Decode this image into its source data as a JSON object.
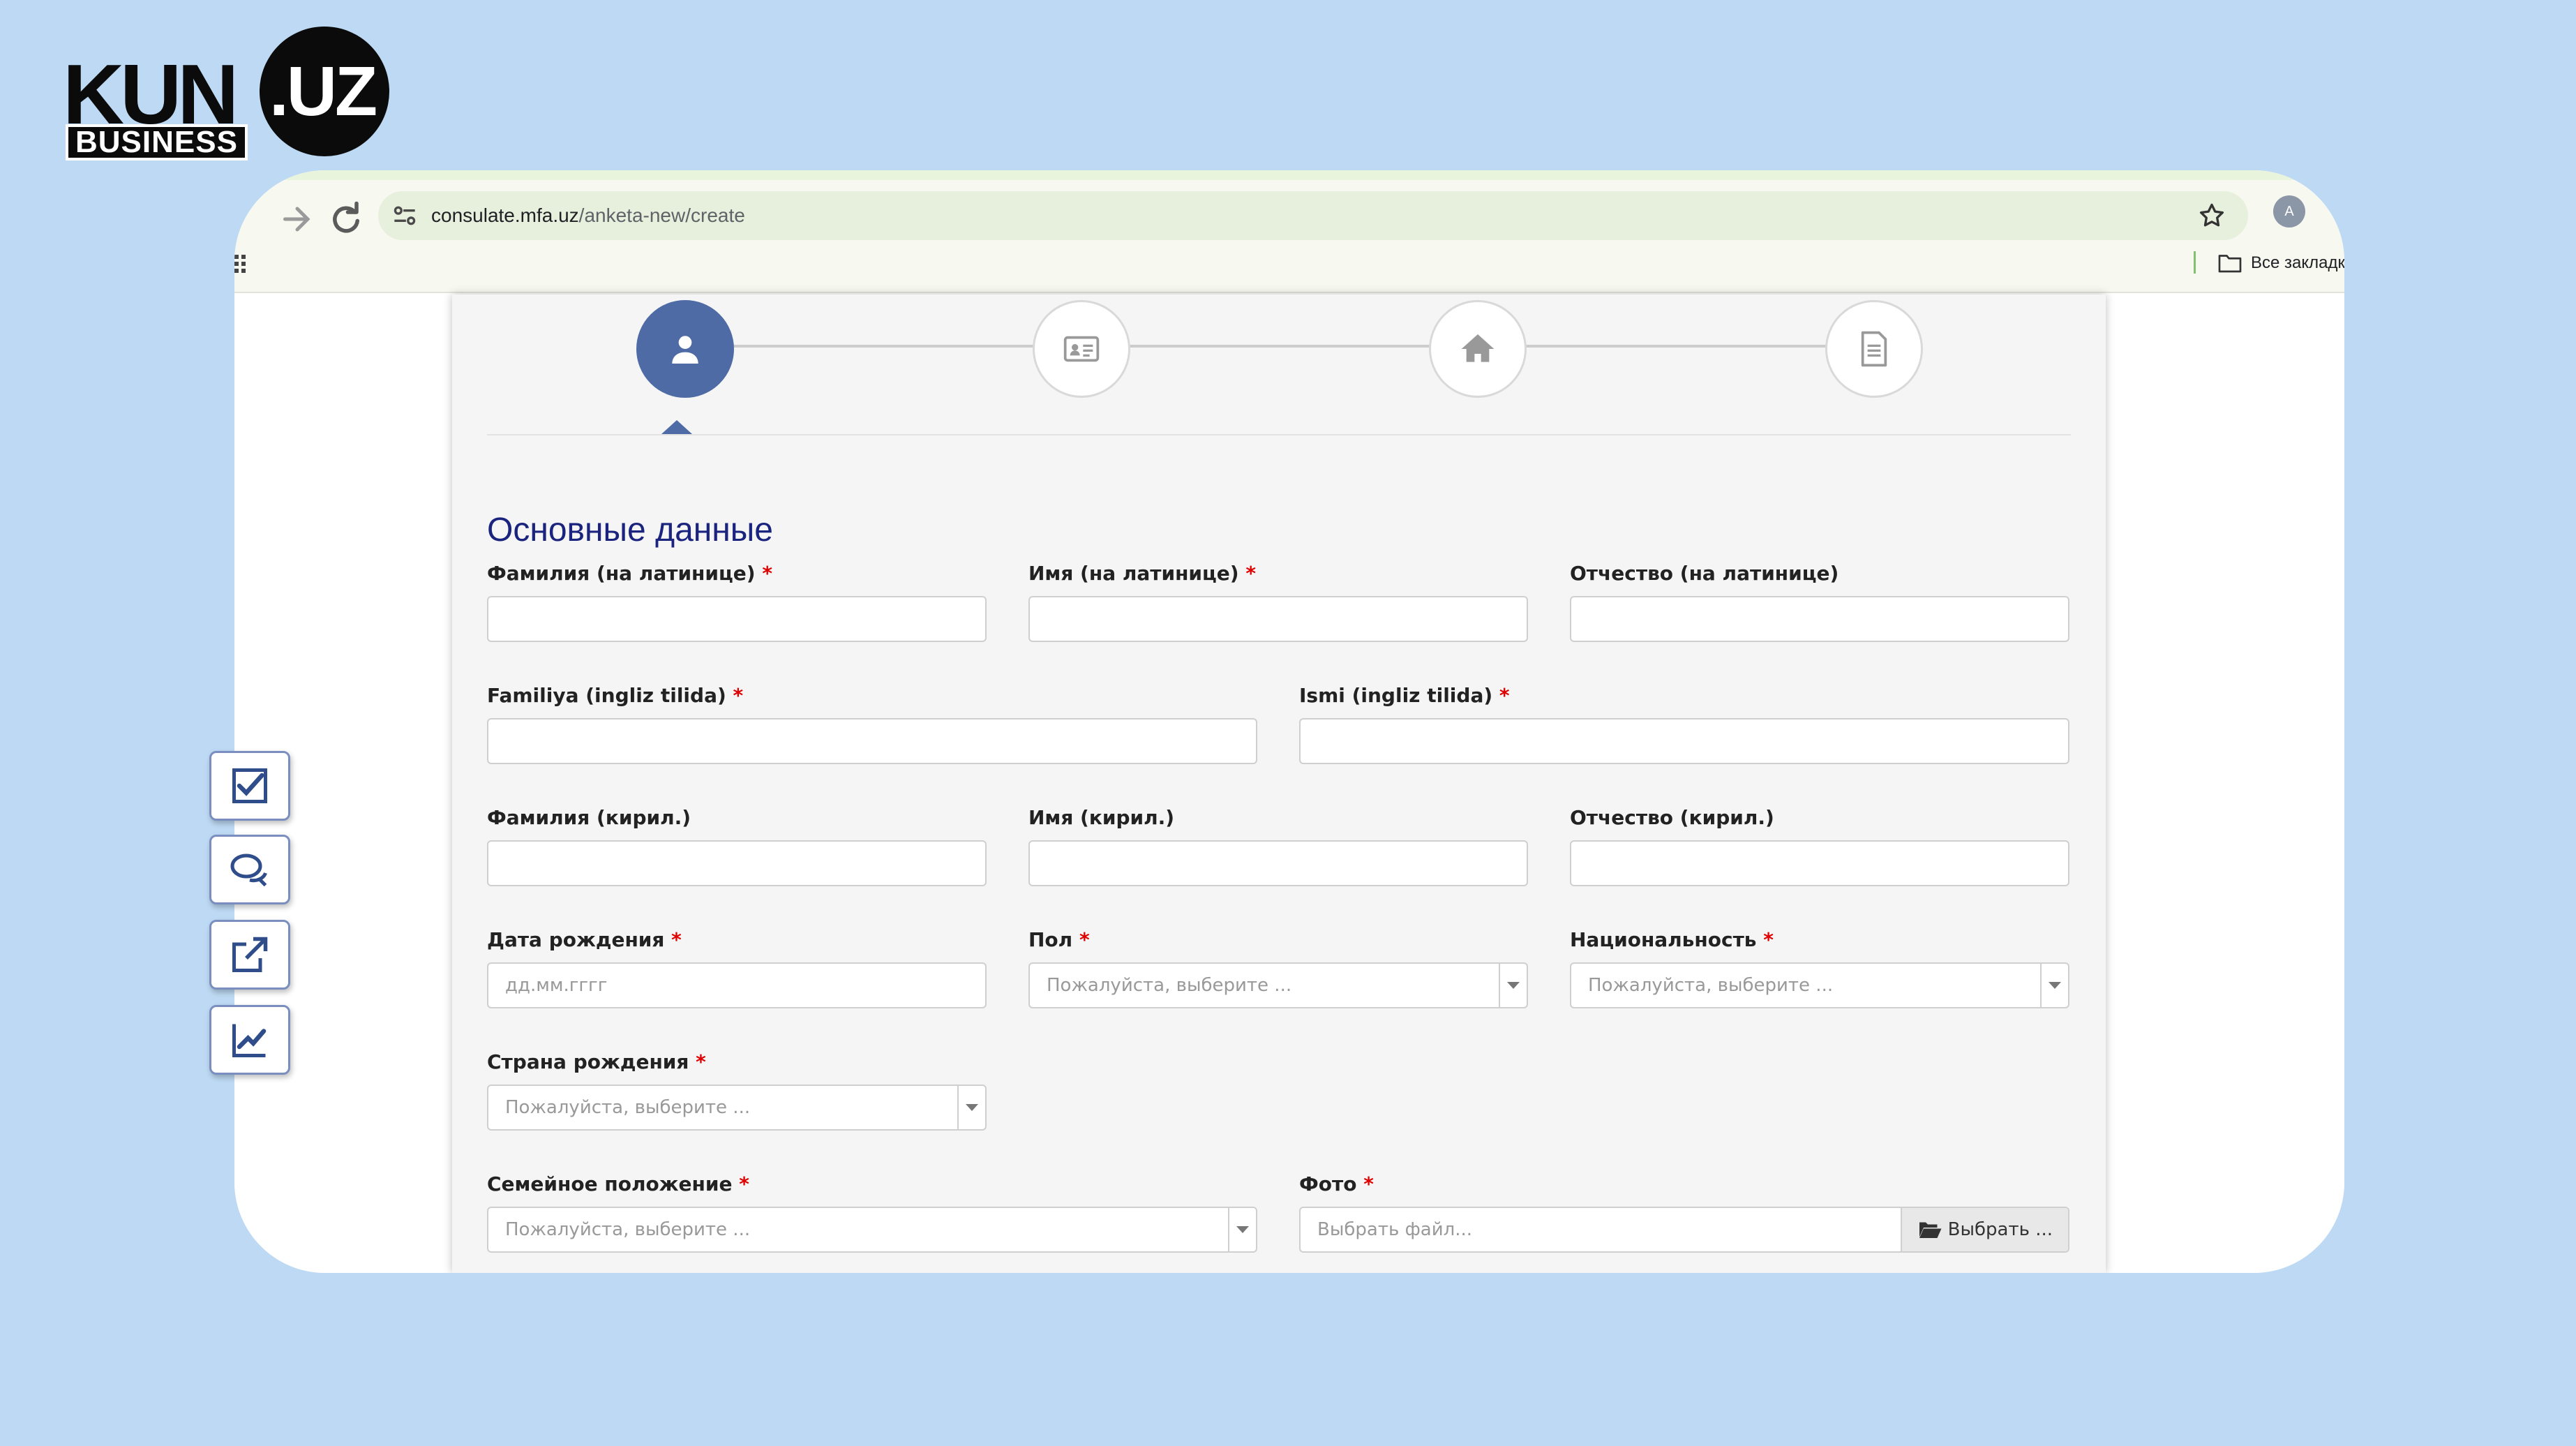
{
  "logo": {
    "kun": "KUN",
    "uz": ".UZ",
    "business": "BUSINESS"
  },
  "browser": {
    "url_host": "consulate.mfa.uz",
    "url_path": "/anketa-new/create",
    "profile_initial": "A",
    "bookmarks_label": "Все закладк"
  },
  "steps": [
    {
      "icon": "user-icon",
      "active": true
    },
    {
      "icon": "id-card-icon",
      "active": false
    },
    {
      "icon": "home-icon",
      "active": false
    },
    {
      "icon": "document-icon",
      "active": false
    }
  ],
  "form": {
    "section_title": "Основные данные",
    "required_mark": "*",
    "fields": {
      "lastname_lat": {
        "label": "Фамилия (на латинице)",
        "value": ""
      },
      "firstname_lat": {
        "label": "Имя (на латинице)",
        "value": ""
      },
      "patronymic_lat": {
        "label": "Отчество (на латинице)",
        "value": ""
      },
      "familiya_eng": {
        "label": "Familiya (ingliz tilida)",
        "value": ""
      },
      "ismi_eng": {
        "label": "Ismi (ingliz tilida)",
        "value": ""
      },
      "lastname_cyr": {
        "label": "Фамилия (кирил.)",
        "value": ""
      },
      "firstname_cyr": {
        "label": "Имя (кирил.)",
        "value": ""
      },
      "patronymic_cyr": {
        "label": "Отчество (кирил.)",
        "value": ""
      },
      "birth_date": {
        "label": "Дата рождения",
        "placeholder": "дд.мм.гггг"
      },
      "gender": {
        "label": "Пол",
        "placeholder": "Пожалуйста, выберите ..."
      },
      "nationality": {
        "label": "Национальность",
        "placeholder": "Пожалуйста, выберите ..."
      },
      "birth_country": {
        "label": "Страна рождения",
        "placeholder": "Пожалуйста, выберите ..."
      },
      "marital_status": {
        "label": "Семейное положение",
        "placeholder": "Пожалуйста, выберите ..."
      },
      "photo": {
        "label": "Фото",
        "placeholder": "Выбрать файл...",
        "button": "Выбрать ..."
      }
    }
  },
  "side_widgets": [
    "checklist-icon",
    "chat-bubbles-icon",
    "share-arrow-icon",
    "trend-chart-icon"
  ],
  "colors": {
    "background": "#bdd9f3",
    "accent": "#4f6ba6",
    "title": "#1a237e",
    "required": "#e00000"
  }
}
